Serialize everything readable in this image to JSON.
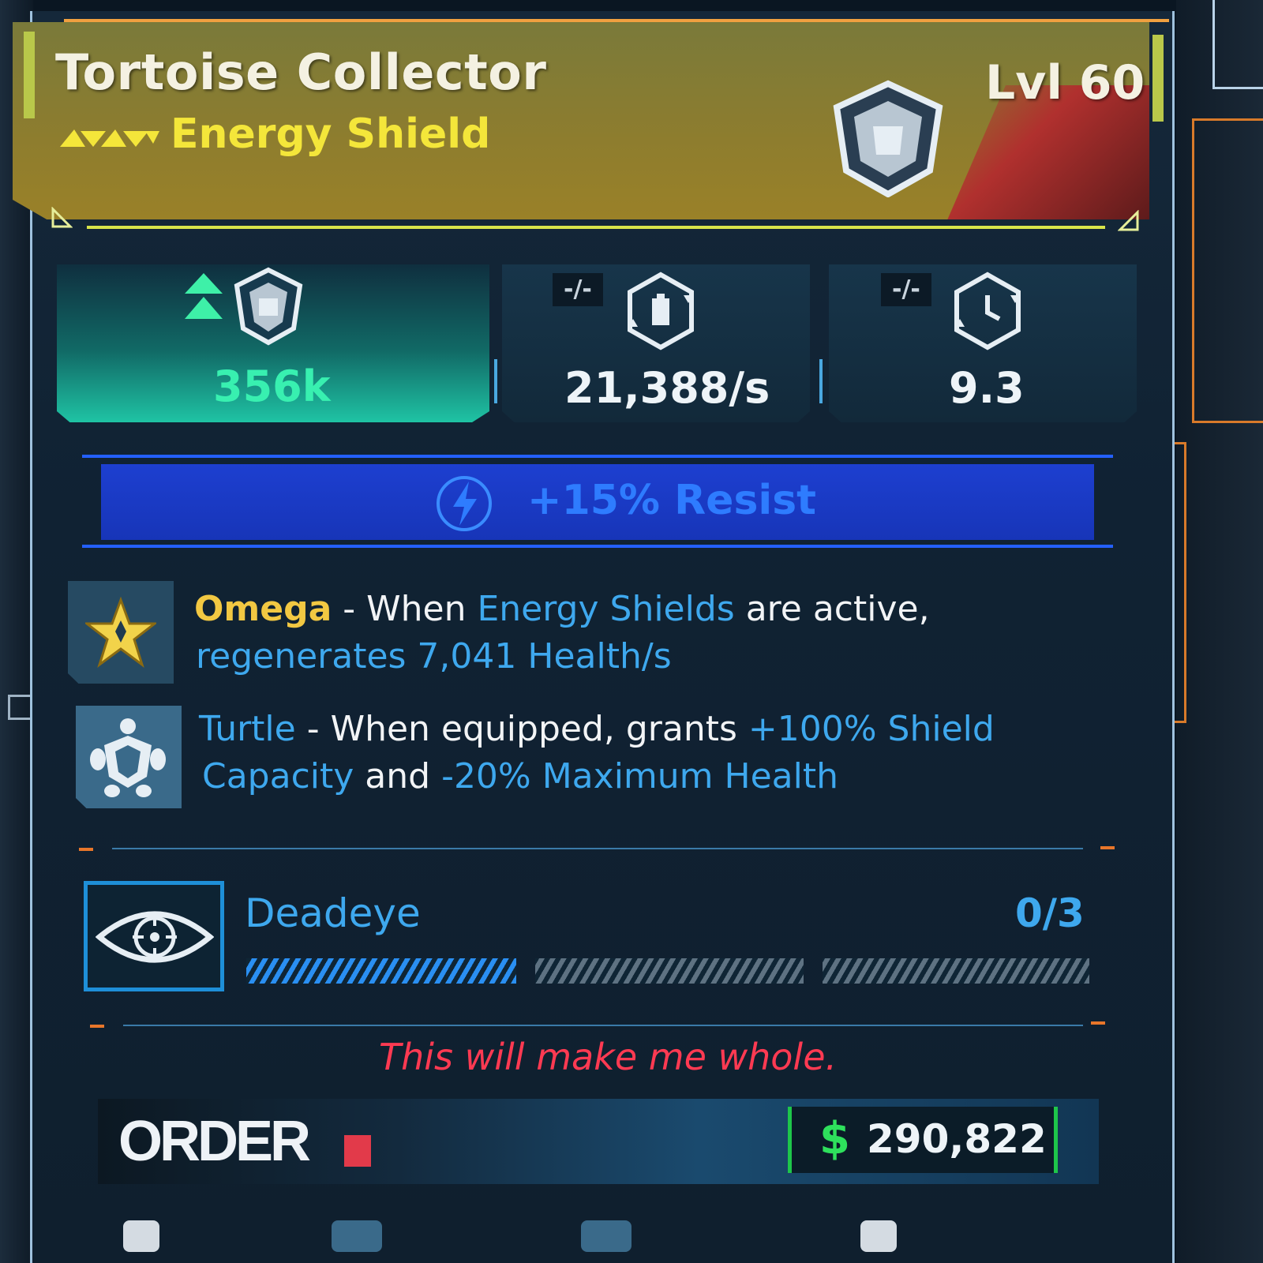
{
  "item": {
    "name": "Tortoise Collector",
    "type": "Energy Shield",
    "level": "Lvl 60",
    "rarity_icon": "legendary-chevrons-icon",
    "emblem_icon": "shield-emblem-icon"
  },
  "stats": [
    {
      "icon": "shield-capacity-icon",
      "value": "356k",
      "upgrade_icon": "double-up-arrow-icon"
    },
    {
      "icon": "recharge-rate-icon",
      "value": "21,388/s",
      "tag": "-/-"
    },
    {
      "icon": "recharge-delay-icon",
      "value": "9.3",
      "tag": "-/-"
    }
  ],
  "resist": {
    "icon": "lightning-icon",
    "text": "+15% Resist"
  },
  "perks": [
    {
      "icon": "omega-star-icon",
      "name": "Omega",
      "dash": " - ",
      "t1": "When ",
      "t2": "Energy Shields",
      "t3": " are active,",
      "t4": "regenerates 7,041 Health/s"
    },
    {
      "icon": "turtle-icon",
      "name": "Turtle",
      "dash": " - ",
      "t1": "When equipped, grants ",
      "t2": "+100% Shield",
      "t3": "Capacity",
      "t4": " and ",
      "t5": "-20% Maximum Health"
    }
  ],
  "set_bonus": {
    "icon": "deadeye-eye-icon",
    "name": "Deadeye",
    "count": "0/3",
    "progress": 0.33
  },
  "flavor": "This will make me whole.",
  "manufacturer": {
    "name": "ORDER",
    "logo": "order-logo"
  },
  "price": {
    "icon": "dollar-icon",
    "symbol": "$",
    "value": "290,822"
  },
  "colors": {
    "rarity_gold": "#f2c842",
    "stat_green": "#38f0b0",
    "link_blue": "#3ea8ee",
    "flavor_red": "#ff3a52",
    "money_green": "#2ee05c"
  }
}
